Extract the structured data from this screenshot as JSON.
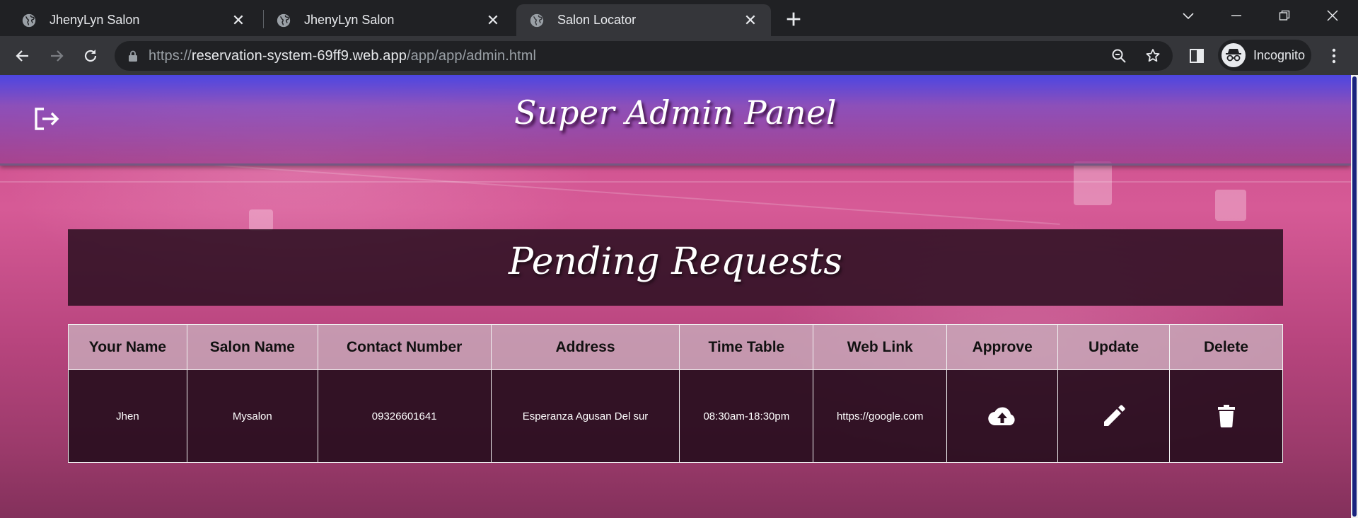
{
  "browser": {
    "tabs": [
      {
        "title": "JhenyLyn Salon",
        "active": false
      },
      {
        "title": "JhenyLyn Salon",
        "active": false
      },
      {
        "title": "Salon Locator",
        "active": true
      }
    ],
    "url": {
      "scheme": "https://",
      "host": "reservation-system-69ff9.web.app",
      "path": "/app/app/admin.html"
    },
    "profile_label": "Incognito"
  },
  "page": {
    "header_title": "Super Admin Panel",
    "section_title": "Pending Requests",
    "table": {
      "headers": [
        "Your Name",
        "Salon Name",
        "Contact Number",
        "Address",
        "Time Table",
        "Web Link",
        "Approve",
        "Update",
        "Delete"
      ],
      "rows": [
        {
          "name": "Jhen",
          "salon": "Mysalon",
          "contact": "09326601641",
          "address": "Esperanza Agusan Del sur",
          "time_table": "08:30am-18:30pm",
          "web_link": "https://google.com"
        }
      ]
    },
    "icons": {
      "logout": "logout-icon",
      "approve": "cloud-upload-icon",
      "update": "pencil-icon",
      "delete": "trash-icon"
    },
    "colors": {
      "header_top": "#4646e6",
      "panel_bg": "#2e1022",
      "table_header_bg": "#c8aab9",
      "accent_pink": "#d65a96"
    }
  }
}
